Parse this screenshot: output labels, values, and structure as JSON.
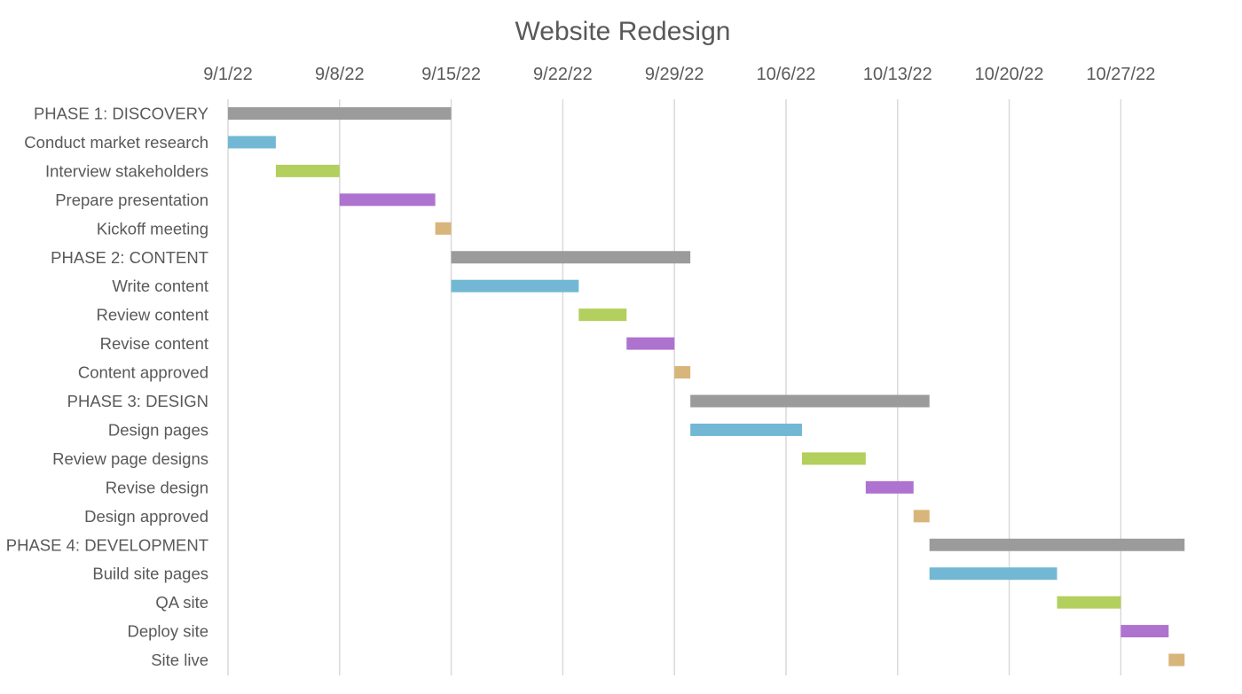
{
  "chart_data": {
    "type": "gantt",
    "title": "Website Redesign",
    "xlabel": "",
    "ylabel": "",
    "x_axis": {
      "start": "2022-09-01",
      "end": "2022-11-01",
      "ticks": [
        "9/1/22",
        "9/8/22",
        "9/15/22",
        "9/22/22",
        "9/29/22",
        "10/6/22",
        "10/13/22",
        "10/20/22",
        "10/27/22"
      ],
      "tick_dates": [
        "2022-09-01",
        "2022-09-08",
        "2022-09-15",
        "2022-09-22",
        "2022-09-29",
        "2022-10-06",
        "2022-10-13",
        "2022-10-20",
        "2022-10-27"
      ],
      "position": "top",
      "grid": true
    },
    "legend": "none",
    "colors": {
      "phase": "#9b9b9b",
      "task1": "#72b8d4",
      "task2": "#b3cf5d",
      "task3": "#ae72cf",
      "milestone": "#d8b57a",
      "grid": "#d9d9d9",
      "text": "#595959"
    },
    "tasks": [
      {
        "label": "PHASE 1: DISCOVERY",
        "start": "2022-09-01",
        "days": 14,
        "kind": "phase"
      },
      {
        "label": "Conduct market research",
        "start": "2022-09-01",
        "days": 3,
        "kind": "task1"
      },
      {
        "label": "Interview stakeholders",
        "start": "2022-09-04",
        "days": 4,
        "kind": "task2"
      },
      {
        "label": "Prepare presentation",
        "start": "2022-09-08",
        "days": 6,
        "kind": "task3"
      },
      {
        "label": "Kickoff meeting",
        "start": "2022-09-14",
        "days": 1,
        "kind": "milestone"
      },
      {
        "label": "PHASE 2: CONTENT",
        "start": "2022-09-15",
        "days": 15,
        "kind": "phase"
      },
      {
        "label": "Write content",
        "start": "2022-09-15",
        "days": 8,
        "kind": "task1"
      },
      {
        "label": "Review content",
        "start": "2022-09-23",
        "days": 3,
        "kind": "task2"
      },
      {
        "label": "Revise content",
        "start": "2022-09-26",
        "days": 3,
        "kind": "task3"
      },
      {
        "label": "Content approved",
        "start": "2022-09-29",
        "days": 1,
        "kind": "milestone"
      },
      {
        "label": "PHASE 3: DESIGN",
        "start": "2022-09-30",
        "days": 15,
        "kind": "phase"
      },
      {
        "label": "Design pages",
        "start": "2022-09-30",
        "days": 7,
        "kind": "task1"
      },
      {
        "label": "Review page designs",
        "start": "2022-10-07",
        "days": 4,
        "kind": "task2"
      },
      {
        "label": "Revise design",
        "start": "2022-10-11",
        "days": 3,
        "kind": "task3"
      },
      {
        "label": "Design approved",
        "start": "2022-10-14",
        "days": 1,
        "kind": "milestone"
      },
      {
        "label": "PHASE 4: DEVELOPMENT",
        "start": "2022-10-15",
        "days": 16,
        "kind": "phase"
      },
      {
        "label": "Build site pages",
        "start": "2022-10-15",
        "days": 8,
        "kind": "task1"
      },
      {
        "label": "QA site",
        "start": "2022-10-23",
        "days": 4,
        "kind": "task2"
      },
      {
        "label": "Deploy site",
        "start": "2022-10-27",
        "days": 3,
        "kind": "task3"
      },
      {
        "label": "Site live",
        "start": "2022-10-30",
        "days": 1,
        "kind": "milestone"
      }
    ]
  }
}
